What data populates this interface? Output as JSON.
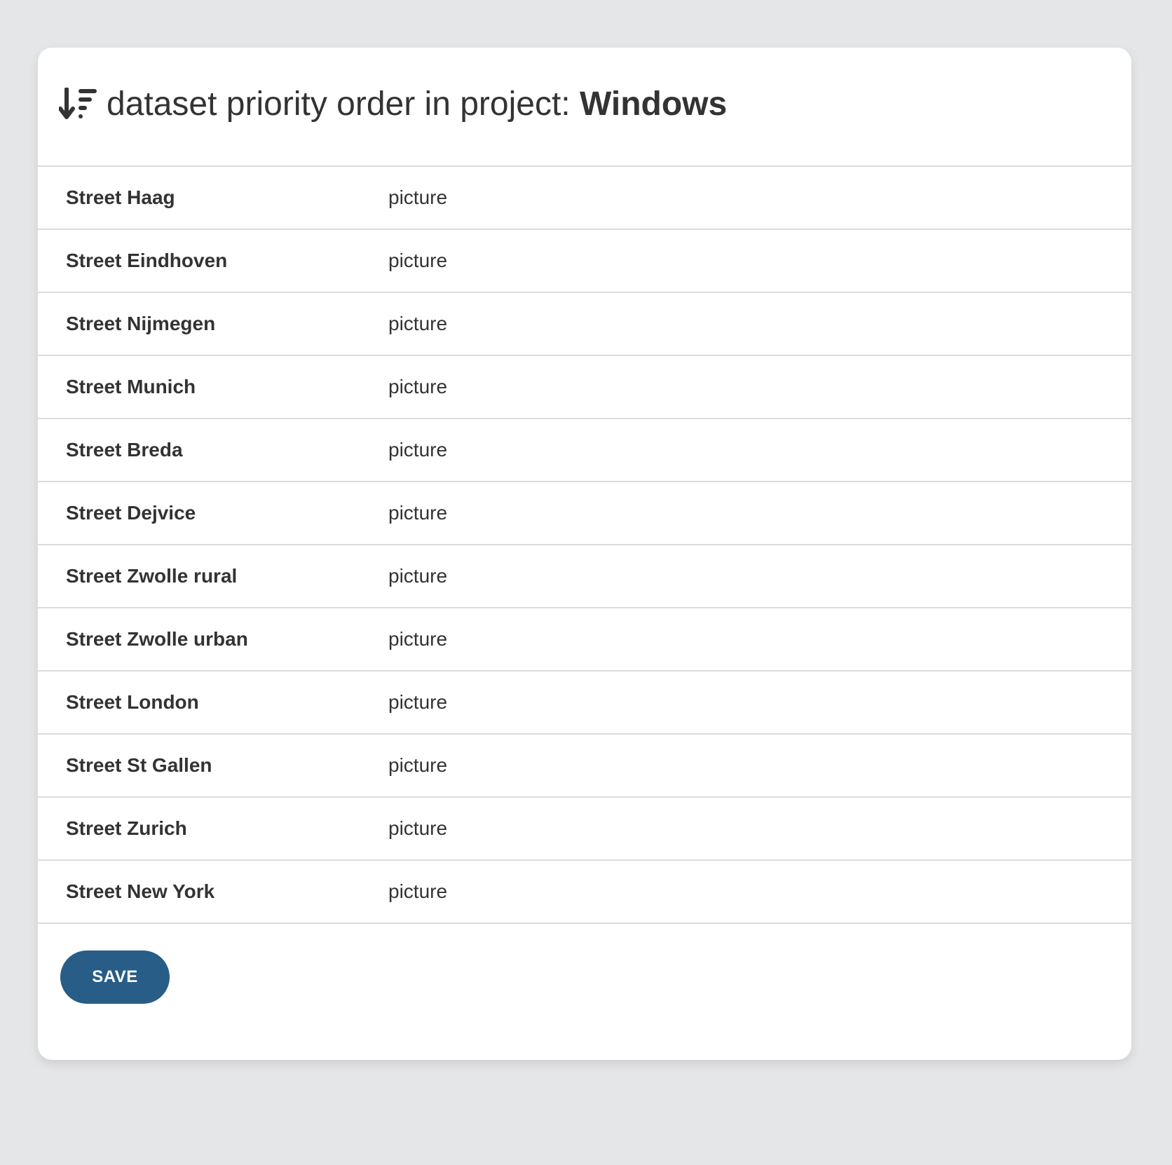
{
  "header": {
    "title_prefix": "dataset priority order in project: ",
    "project_name": "Windows",
    "icon": "sort-amount-down-icon"
  },
  "datasets": [
    {
      "name": "Street Haag",
      "type": "picture"
    },
    {
      "name": "Street Eindhoven",
      "type": "picture"
    },
    {
      "name": "Street Nijmegen",
      "type": "picture"
    },
    {
      "name": "Street Munich",
      "type": "picture"
    },
    {
      "name": "Street Breda",
      "type": "picture"
    },
    {
      "name": "Street Dejvice",
      "type": "picture"
    },
    {
      "name": "Street Zwolle rural",
      "type": "picture"
    },
    {
      "name": "Street Zwolle urban",
      "type": "picture"
    },
    {
      "name": "Street London",
      "type": "picture"
    },
    {
      "name": "Street St Gallen",
      "type": "picture"
    },
    {
      "name": "Street Zurich",
      "type": "picture"
    },
    {
      "name": "Street New York",
      "type": "picture"
    }
  ],
  "footer": {
    "save_label": "SAVE"
  },
  "colors": {
    "background": "#e5e6e8",
    "card": "#ffffff",
    "text": "#333333",
    "accent": "#275d86",
    "divider": "#dcdcdc"
  }
}
